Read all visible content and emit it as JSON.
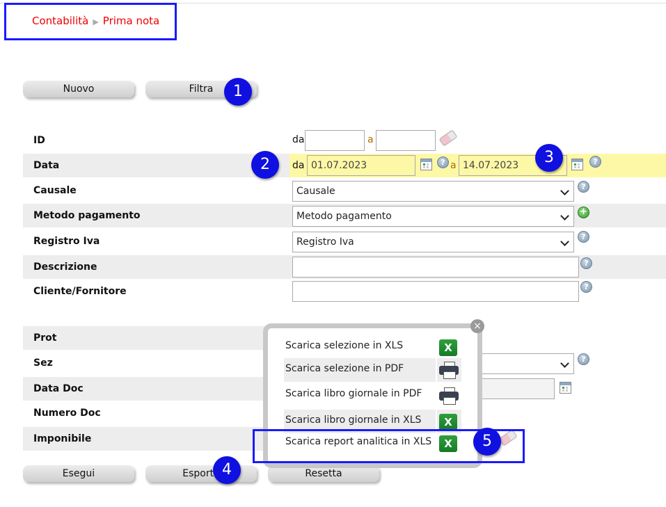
{
  "breadcrumb": {
    "section": "Contabilità",
    "page": "Prima nota"
  },
  "toolbar": {
    "new_label": "Nuovo",
    "filter_label": "Filtra"
  },
  "annotations": [
    "1",
    "2",
    "3",
    "4",
    "5"
  ],
  "filters": {
    "id": {
      "label": "ID",
      "from_label": "da",
      "to_label": "a",
      "from_value": "",
      "to_value": ""
    },
    "date": {
      "label": "Data",
      "from_label": "da",
      "to_label": "a",
      "from_value": "01.07.2023",
      "to_value": "14.07.2023"
    },
    "causale": {
      "label": "Causale",
      "selected": "Causale"
    },
    "payment_method": {
      "label": "Metodo pagamento",
      "selected": "Metodo pagamento"
    },
    "vat_register": {
      "label": "Registro Iva",
      "selected": "Registro Iva"
    },
    "description": {
      "label": "Descrizione",
      "value": ""
    },
    "customer_supplier": {
      "label": "Cliente/Fornitore",
      "value": ""
    },
    "prot": {
      "label": "Prot"
    },
    "sez": {
      "label": "Sez"
    },
    "doc_date": {
      "label": "Data Doc"
    },
    "doc_number": {
      "label": "Numero Doc"
    },
    "taxable": {
      "label": "Imponibile"
    }
  },
  "export_menu": {
    "items": [
      {
        "label": "Scarica selezione in XLS",
        "icon": "excel-icon"
      },
      {
        "label": "Scarica selezione in PDF",
        "icon": "printer-icon"
      },
      {
        "label": "Scarica libro giornale in PDF",
        "icon": "printer-icon"
      },
      {
        "label": "Scarica libro giornale in XLS",
        "icon": "excel-icon"
      },
      {
        "label": "Scarica report analitica in XLS",
        "icon": "excel-icon"
      }
    ]
  },
  "actions": {
    "run_label": "Esegui",
    "export_label": "Esporta",
    "reset_label": "Resetta"
  },
  "colors": {
    "accent_red": "#e00000",
    "highlight_blue": "#1010e0",
    "date_row_yellow": "#fdf8a6"
  }
}
